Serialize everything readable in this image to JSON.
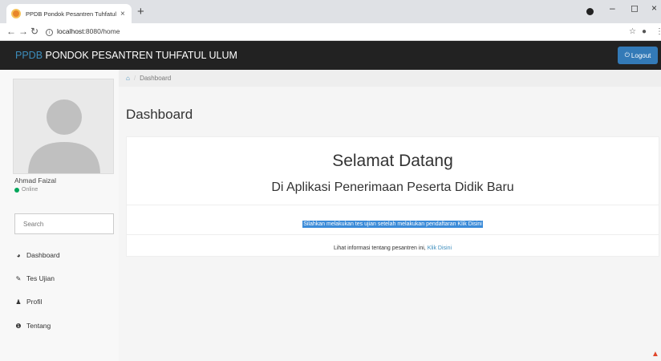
{
  "browser": {
    "tab_title": "PPDB Pondok Pesantren Tuhfatul",
    "tab_close": "×",
    "new_tab": "+",
    "url_host": "localhost",
    "url_rest": ":8080/home",
    "window_controls": [
      "–",
      "◻",
      "×"
    ]
  },
  "navbar": {
    "brand_accent": "PPDB",
    "brand_rest": " PONDOK PESANTREN TUHFATUL ULUM",
    "logout_label": "Logout"
  },
  "sidebar": {
    "user_name": "Ahmad Faizal",
    "status": "Online",
    "search_placeholder": "Search",
    "items": [
      {
        "label": "Dashboard",
        "icon": "dashboard-icon"
      },
      {
        "label": "Tes Ujian",
        "icon": "edit-icon"
      },
      {
        "label": "Profil",
        "icon": "user-icon"
      },
      {
        "label": "Tentang",
        "icon": "info-icon"
      }
    ]
  },
  "main": {
    "breadcrumb": "Dashboard",
    "page_title": "Dashboard",
    "welcome_title": "Selamat Datang",
    "welcome_subtitle": "Di Aplikasi Penerimaan Peserta Didik Baru",
    "highlight_text": "Silahkan melakukan tes ujian setelah melakukan pendaftaran Klik Disini",
    "info_text": "Lihat informasi tentang pesantren ini, ",
    "info_link": "Klik Disini"
  },
  "colors": {
    "navbar_bg": "#222222",
    "brand_accent": "#3c8dbc",
    "logout_button": "#337ab7",
    "online": "#00a65a",
    "selection": "#3b8bd8"
  }
}
